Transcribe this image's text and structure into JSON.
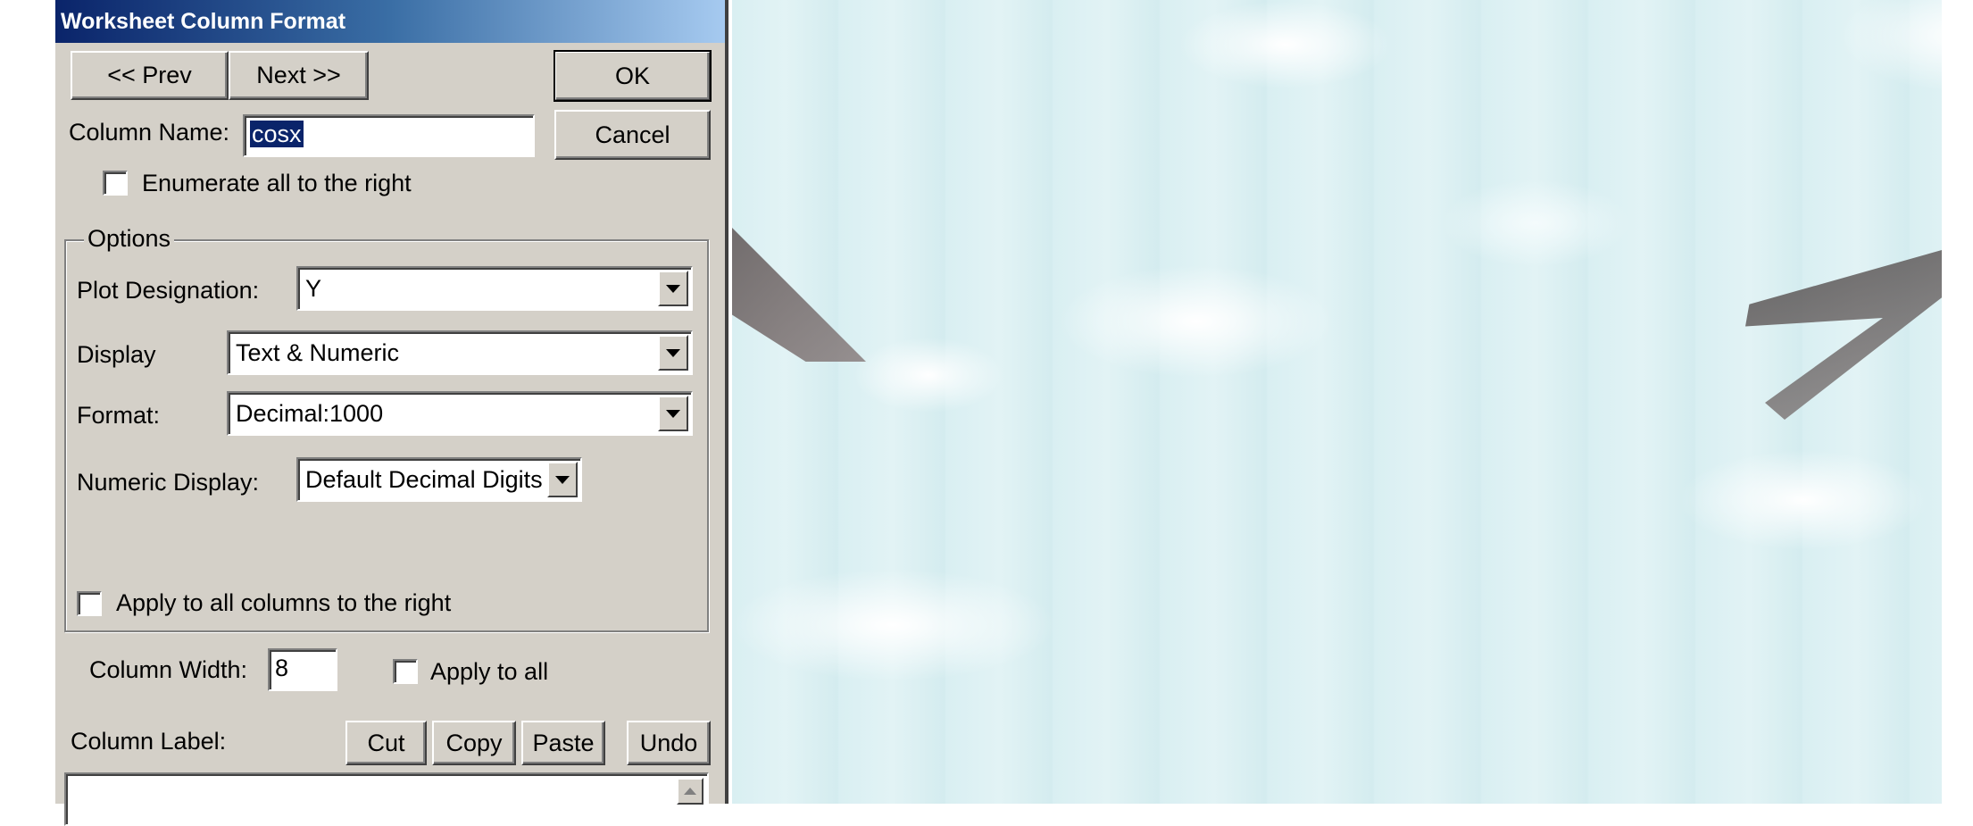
{
  "dialog": {
    "title": "Worksheet Column Format",
    "prev_label": "<< Prev",
    "next_label": "Next >>",
    "ok_label": "OK",
    "cancel_label": "Cancel",
    "column_name_label": "Column Name:",
    "column_name_value": "cosx",
    "enumerate_label": "Enumerate all to the right",
    "enumerate_checked": false
  },
  "options": {
    "group_title": "Options",
    "plot_designation_label": "Plot Designation:",
    "plot_designation_value": "Y",
    "display_label": "Display",
    "display_value": "Text & Numeric",
    "format_label": "Format:",
    "format_value": "Decimal:1000",
    "numeric_display_label": "Numeric Display:",
    "numeric_display_value": "Default Decimal Digits",
    "apply_all_right_label": "Apply to all columns to the right",
    "apply_all_right_checked": false
  },
  "width": {
    "label": "Column Width:",
    "value": "8",
    "apply_all_label": "Apply to all",
    "apply_all_checked": false
  },
  "label_section": {
    "label": "Column Label:",
    "cut_label": "Cut",
    "copy_label": "Copy",
    "paste_label": "Paste",
    "undo_label": "Undo",
    "value": ""
  },
  "colors": {
    "dialog_bg": "#d4d0c8",
    "title_start": "#0a246a",
    "title_end": "#a6caf0",
    "selection": "#0a246a",
    "sky": "#d9eff2"
  }
}
